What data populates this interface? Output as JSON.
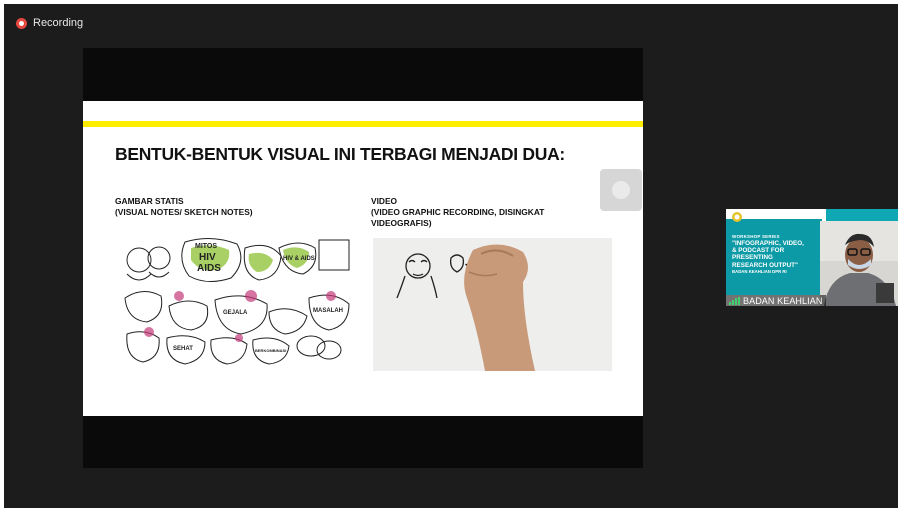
{
  "recording": {
    "label": "Recording"
  },
  "slide": {
    "title": "BENTUK-BENTUK VISUAL INI TERBAGI MENJADI DUA:",
    "left_heading_line1": "GAMBAR STATIS",
    "left_heading_line2": "(VISUAL NOTES/ SKETCH NOTES)",
    "right_heading_line1": "VIDEO",
    "right_heading_line2": "(VIDEO GRAPHIC RECORDING, DISINGKAT",
    "right_heading_line3": "VIDEOGRAFIS)",
    "sketch_words": [
      "MITOS",
      "HIV",
      "AIDS",
      "HIV & AIDS",
      "GEJALA",
      "MASALAH",
      "BERKOMBINASI",
      "SEHAT"
    ]
  },
  "participant": {
    "name": "BADAN KEAHLIAN",
    "series": "WORKSHOP SERIES",
    "headline_line1": "\"INFOGRAPHIC, VIDEO,",
    "headline_line2": "& PODCAST FOR PRESENTING",
    "headline_line3": "RESEARCH OUTPUT\"",
    "org": "BADAN KEAHLIAN DPR RI"
  },
  "colors": {
    "meeting_bg": "#1c1c1c",
    "recording_dot": "#e5483f",
    "slide_accent": "#ffed00",
    "tile_teal": "#0c9aa6",
    "signal_green": "#3ed16d"
  }
}
